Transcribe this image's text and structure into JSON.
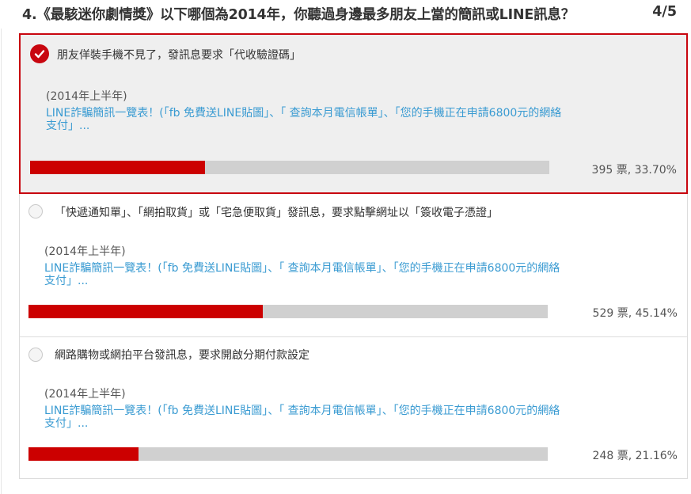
{
  "question": {
    "title": "4.《最駭迷你劇情獎》以下哪個為2014年，你聽過身邊最多朋友上當的簡訊或LINE訊息？",
    "progress": "4/5"
  },
  "options": [
    {
      "label": "朋友佯裝手機不見了，發訊息要求「代收驗證碼」",
      "date": "(2014年上半年)",
      "link_line1": "LINE詐騙簡訊一覽表！(「fb 免費送LINE貼圖」、「 查詢本月電信帳單」、「您的手機正在申請6800元的網絡",
      "link_line2": "支付」...",
      "votes": "395 票, 33.70%",
      "percent": 33.7,
      "selected": true
    },
    {
      "label": "「快遞通知單」、「網拍取貨」或「宅急便取貨」發訊息，要求點擊網址以「簽收電子憑證」",
      "date": "(2014年上半年)",
      "link_line1": "LINE詐騙簡訊一覽表！(「fb 免費送LINE貼圖」、「 查詢本月電信帳單」、「您的手機正在申請6800元的網絡",
      "link_line2": "支付」...",
      "votes": "529 票, 45.14%",
      "percent": 45.14,
      "selected": false
    },
    {
      "label": "網路購物或網拍平台發訊息，要求開啟分期付款設定",
      "date": "(2014年上半年)",
      "link_line1": "LINE詐騙簡訊一覽表！(「fb 免費送LINE貼圖」、「 查詢本月電信帳單」、「您的手機正在申請6800元的網絡",
      "link_line2": "支付」...",
      "votes": "248 票, 21.16%",
      "percent": 21.16,
      "selected": false
    }
  ],
  "colors": {
    "accent": "#c8060f",
    "bar_fill": "#cc0000",
    "bar_track": "#d0d0d0",
    "link": "#3a9bd2"
  },
  "icons": {
    "selected": "check-icon",
    "unselected": "radio-circle-icon"
  }
}
